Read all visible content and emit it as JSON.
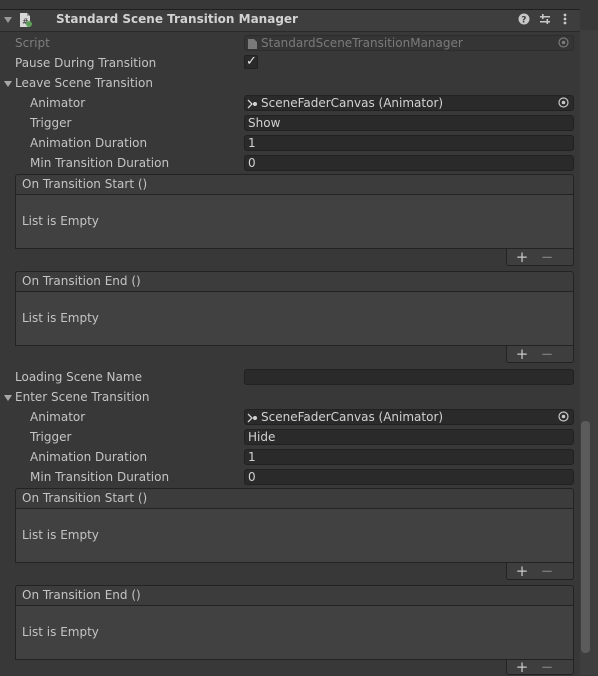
{
  "component": {
    "title": "Standard Scene Transition Manager",
    "icon": "script-component-icon",
    "header_icons": [
      "help-icon",
      "preset-sliders-icon",
      "kebab-menu-icon"
    ]
  },
  "script": {
    "label": "Script",
    "value": "StandardSceneTransitionManager"
  },
  "pause": {
    "label": "Pause During Transition",
    "checked": true,
    "check_glyph": "✓"
  },
  "leave": {
    "label": "Leave Scene Transition",
    "animator": {
      "label": "Animator",
      "value": "SceneFaderCanvas (Animator)"
    },
    "trigger": {
      "label": "Trigger",
      "value": "Show"
    },
    "duration": {
      "label": "Animation Duration",
      "value": "1"
    },
    "min_duration": {
      "label": "Min Transition Duration",
      "value": "0"
    },
    "on_start": {
      "label": "On Transition Start ()",
      "empty": "List is Empty"
    },
    "on_end": {
      "label": "On Transition End ()",
      "empty": "List is Empty"
    }
  },
  "loading": {
    "label": "Loading Scene Name",
    "value": ""
  },
  "enter": {
    "label": "Enter Scene Transition",
    "animator": {
      "label": "Animator",
      "value": "SceneFaderCanvas (Animator)"
    },
    "trigger": {
      "label": "Trigger",
      "value": "Hide"
    },
    "duration": {
      "label": "Animation Duration",
      "value": "1"
    },
    "min_duration": {
      "label": "Min Transition Duration",
      "value": "0"
    },
    "on_start": {
      "label": "On Transition Start ()",
      "empty": "List is Empty"
    },
    "on_end": {
      "label": "On Transition End ()",
      "empty": "List is Empty"
    }
  },
  "list_buttons": {
    "add": "+",
    "remove": "−"
  }
}
